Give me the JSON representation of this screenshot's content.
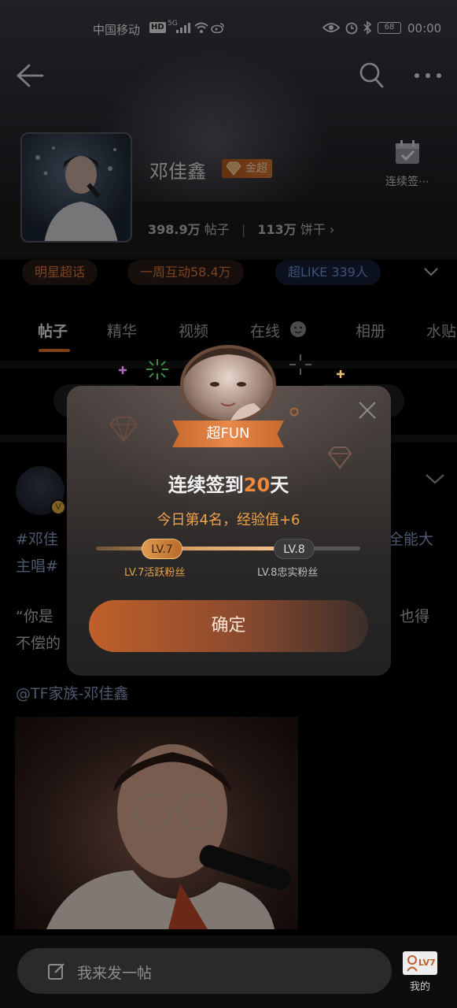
{
  "status_bar": {
    "carrier": "中国移动",
    "hd": "HD",
    "signal_tag": "5G",
    "battery": "68",
    "time": "00:00"
  },
  "header": {
    "name": "邓佳鑫",
    "badge": "金超",
    "checkin_label": "连续签⋯",
    "posts_count": "398.9万",
    "posts_label": "帖子",
    "cookies_count": "113万",
    "cookies_label": "饼干",
    "separator": "|",
    "chevron": "›"
  },
  "tags": [
    {
      "label": "明星超话"
    },
    {
      "label": "一周互动58.4万"
    },
    {
      "label": "超LIKE 339人"
    }
  ],
  "tabs": [
    {
      "label": "帖子"
    },
    {
      "label": "精华"
    },
    {
      "label": "视频"
    },
    {
      "label": "在线"
    },
    {
      "label": "相册"
    },
    {
      "label": "水贴"
    }
  ],
  "feed": {
    "line1_left": "#邓佳",
    "line1_right": "全能大",
    "line2_left": "主唱#",
    "line3_left": "“你是",
    "line3_right": "也得",
    "line4_left": "不偿的",
    "mention": "@TF家族-邓佳鑫"
  },
  "modal": {
    "ribbon": "超FUN",
    "title_prefix": "连续签到",
    "title_days": "20",
    "title_suffix": "天",
    "subtitle": "今日第4名，经验值+6",
    "level_current": "LV.7",
    "level_next": "LV.8",
    "level_current_caption": "LV.7活跃粉丝",
    "level_next_caption": "LV.8忠实粉丝",
    "level_progress": 0.72,
    "confirm": "确定"
  },
  "bottom": {
    "post_placeholder": "我来发一帖",
    "me_label": "我的",
    "me_level": "LV7"
  },
  "colors": {
    "accent": "#e0752a",
    "hashtag": "#8aa3c8",
    "gold": "#f0a24a"
  }
}
